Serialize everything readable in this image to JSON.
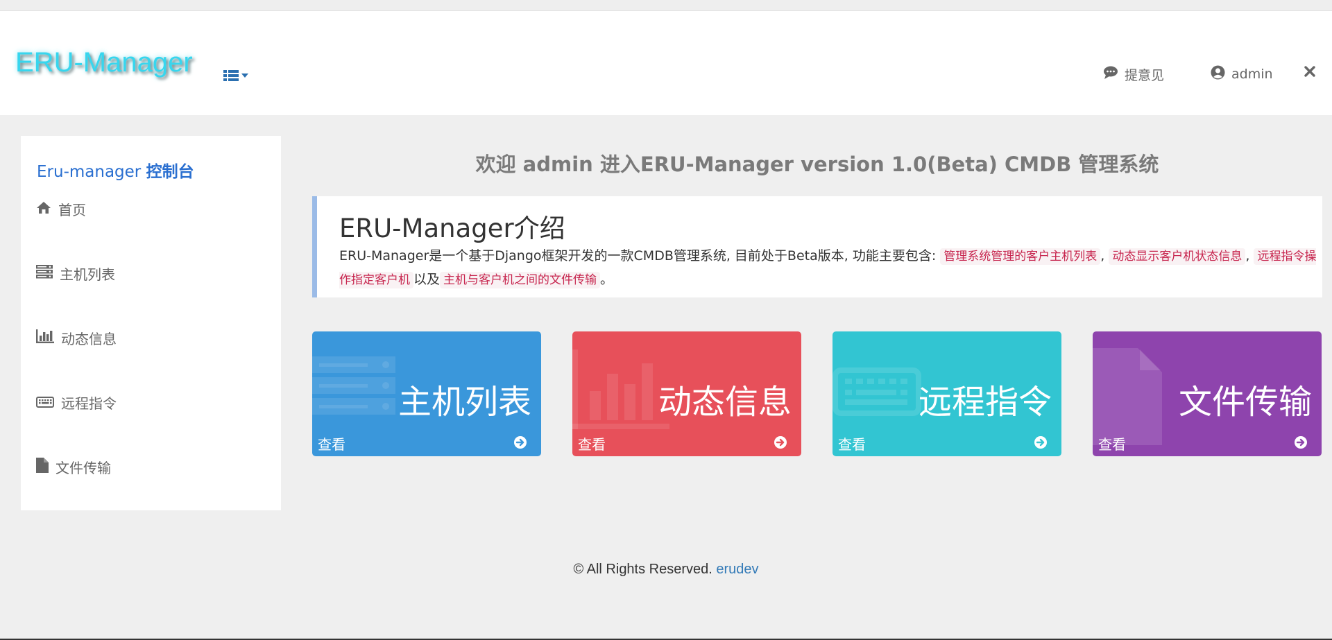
{
  "navbar": {
    "brand": "ERU-Manager",
    "menu_icon": "list-icon",
    "feedback_label": "提意见",
    "user_label": "admin",
    "close_icon": "close-icon"
  },
  "sidebar": {
    "title_prefix": "Eru-manager ",
    "title_bold": "控制台",
    "items": [
      {
        "label": "首页",
        "icon": "home-icon"
      },
      {
        "label": "主机列表",
        "icon": "server-icon"
      },
      {
        "label": "动态信息",
        "icon": "bar-chart-icon"
      },
      {
        "label": "远程指令",
        "icon": "keyboard-icon"
      },
      {
        "label": "文件传输",
        "icon": "file-icon"
      }
    ]
  },
  "main": {
    "welcome": "欢迎 admin 进入ERU-Manager version 1.0(Beta) CMDB 管理系统",
    "intro": {
      "title": "ERU-Manager介绍",
      "text_before": "ERU-Manager是一个基于Django框架开发的一款CMDB管理系统, 目前处于Beta版本, 功能主要包含: ",
      "features": [
        "管理系统管理的客户主机列表",
        "动态显示客户机状态信息",
        "远程指令操作指定客户机",
        "主机与客户机之间的文件传输"
      ],
      "sep1": ", ",
      "sep2": ", ",
      "sep3": "以及",
      "end": "。"
    },
    "tiles": [
      {
        "label": "主机列表",
        "view": "查看",
        "color": "#3a97db"
      },
      {
        "label": "动态信息",
        "view": "查看",
        "color": "#e7505a"
      },
      {
        "label": "远程指令",
        "view": "查看",
        "color": "#32c5d2"
      },
      {
        "label": "文件传输",
        "view": "查看",
        "color": "#8e44ad"
      }
    ]
  },
  "footer": {
    "text": "© All Rights Reserved. ",
    "link": "erudev"
  }
}
